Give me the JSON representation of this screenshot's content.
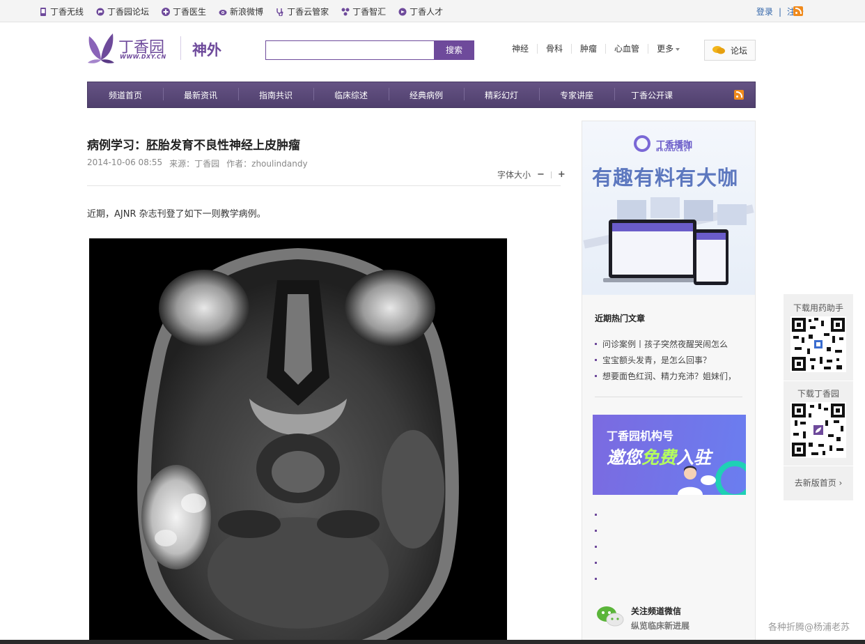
{
  "topbar": {
    "links": [
      {
        "label": "丁香无线",
        "icon": "phone-icon",
        "color": "#6e4a9b"
      },
      {
        "label": "丁香园论坛",
        "icon": "forum-icon",
        "color": "#6e4a9b"
      },
      {
        "label": "丁香医生",
        "icon": "plus-circle-icon",
        "color": "#6e4a9b"
      },
      {
        "label": "新浪微博",
        "icon": "weibo-icon",
        "color": "#6e4a9b"
      },
      {
        "label": "丁香云管家",
        "icon": "stethoscope-icon",
        "color": "#6e4a9b"
      },
      {
        "label": "丁香智汇",
        "icon": "network-icon",
        "color": "#6e4a9b"
      },
      {
        "label": "丁香人才",
        "icon": "talent-icon",
        "color": "#6e4a9b"
      }
    ],
    "login": "登录",
    "register": "注册"
  },
  "header": {
    "brand": "丁香园",
    "brand_url": "WWW.DXY.CN",
    "channel": "神外",
    "search_button": "搜索",
    "search_placeholder": "",
    "subnav": [
      "神经",
      "骨科",
      "肿瘤",
      "心血管",
      "更多"
    ],
    "forum_button": "论坛"
  },
  "mainnav": {
    "items": [
      "频道首页",
      "最新资讯",
      "指南共识",
      "临床综述",
      "经典病例",
      "精彩幻灯",
      "专家讲座",
      "丁香公开课"
    ]
  },
  "article": {
    "title": "病例学习：胚胎发育不良性神经上皮肿瘤",
    "date": "2014-10-06 08:55",
    "source": "来源：丁香园",
    "author": "作者：zhoulindandy",
    "font_size_label": "字体大小",
    "font_decrease": "−",
    "font_increase": "+",
    "intro": "近期，AJNR 杂志刊登了如下一则教学病例。"
  },
  "sidebar": {
    "broadcast_brand": "丁香播咖",
    "broadcast_sub": "BROADCAST",
    "broadcast_headline": "有趣有料有大咖",
    "hot_title": "近期热门文章",
    "hot_items": [
      "问诊案例丨孩子突然夜醒哭闹怎么",
      "宝宝额头发青，是怎么回事？",
      "想要面色红润、精力充沛？姐妹们，"
    ],
    "org_line1": "丁香园机构号",
    "org_line2_a": "邀您",
    "org_line2_b": "免费",
    "org_line2_c": "入驻",
    "wechat_title": "关注频道微信",
    "wechat_sub": "纵览临床新进展"
  },
  "float": {
    "app_caption": "下载用药助手",
    "dxy_caption": "下载丁香园",
    "new_home": "去新版首页 ›"
  },
  "watermark": "各种折腾@杨浦老苏",
  "colors": {
    "brand_purple": "#6e4a9b",
    "nav_bg": "#5a4a78",
    "rss_orange": "#f08a1c",
    "link_blue": "#3366aa"
  }
}
